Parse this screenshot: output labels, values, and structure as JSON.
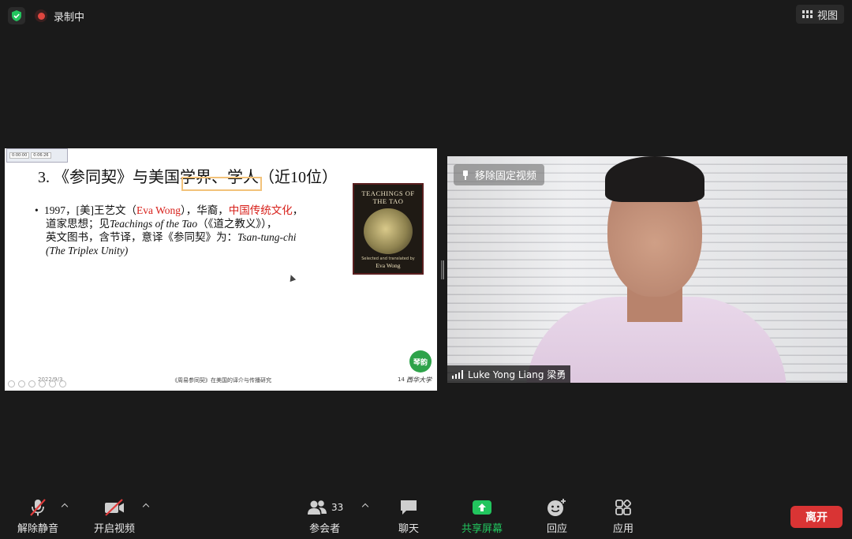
{
  "topbar": {
    "recording_label": "录制中",
    "view_label": "视图"
  },
  "slide": {
    "title": "3. 《参同契》与美国学界、学人（近10位）",
    "bullet": {
      "marker": "•",
      "p1": "1997，[美]王艺文（",
      "p1_red": "Eva Wong",
      "p2": "），华裔，",
      "p2_red": "中国传统文化",
      "p3": "，",
      "line2a": "道家思想；见",
      "line2_italic": "Teachings of the Tao",
      "line2b": "（《道之教义》），",
      "line3a": "英文图书，含节译，意译《参同契》为：",
      "line3_italic": "Tsan-tung-chi",
      "line4_italic": "(The Triplex Unity)"
    },
    "book": {
      "title_line1": "TEACHINGS OF",
      "title_line2": "THE TAO",
      "credit": "Selected and translated by",
      "author": "Eva Wong"
    },
    "mini_player": {
      "time_a": "0:00:00",
      "time_b": "0:06:26"
    },
    "logo_text": "琴韵",
    "footer_date": "2022/9/3",
    "footer_center": "《周易参同契》在美国的译介与传播研究",
    "page_number": "14",
    "university": "西华大学"
  },
  "video": {
    "unpin_label": "移除固定视频",
    "participant_name": "Luke Yong Liang 梁勇"
  },
  "toolbar": {
    "unmute_label": "解除静音",
    "start_video_label": "开启视频",
    "participants_label": "参会者",
    "participants_count": "33",
    "chat_label": "聊天",
    "share_label": "共享屏幕",
    "reactions_label": "回应",
    "apps_label": "应用",
    "leave_label": "离开"
  },
  "colors": {
    "accent_green": "#22c55e",
    "leave_red": "#d93434",
    "slide_red": "#d7201a"
  }
}
